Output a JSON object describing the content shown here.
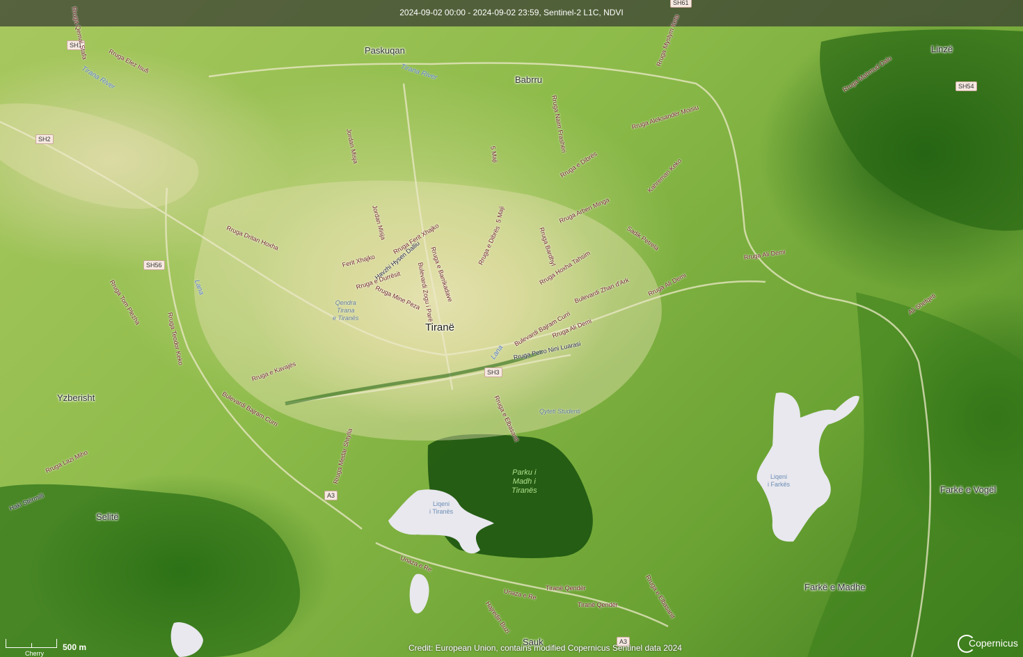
{
  "header": {
    "title": "2024-09-02 00:00 - 2024-09-02 23:59, Sentinel-2 L1C, NDVI"
  },
  "places": {
    "paskuqan": "Paskuqan",
    "babrru": "Babrru",
    "linze": "Linzë",
    "tirane": "Tiranë",
    "yzberisht": "Yzberisht",
    "selite": "Selitë",
    "farke_vogel": "Farkë e Vogël",
    "farke_madhe": "Farkë e Madhe",
    "sauk": "Sauk"
  },
  "shields": {
    "sh1": "SH1",
    "sh2": "SH2",
    "sh56": "SH56",
    "sh3": "SH3",
    "sh54": "SH54",
    "sh61": "SH61",
    "a3_west": "A3",
    "a3_east": "A3"
  },
  "water": {
    "tirana_river_west": "Tirana River",
    "tirana_river_north": "Tirana River",
    "lana_west": "Lana",
    "lana_center": "Lana"
  },
  "lakes": {
    "tirana": "Liqeni\ni Tiranës",
    "farkes": "Liqeni\ni Farkës"
  },
  "parks": {
    "grand_park": "Parku i\nMadh i\nTiranës"
  },
  "pois": {
    "center": "Qendra\nTirana\ne Tiranës",
    "student_city": "Qyteti Studenti"
  },
  "streets": {
    "elez_isufi": "Rruga Elez Isufi",
    "qemal_stafa": "Rruga Qemal Stafa",
    "myslym": "Rruga Myslym Keta",
    "mahmud_dalu": "Rruga Mahmud Dalu",
    "jordan_misja_1": "Jordan Misja",
    "jordan_misja_2": "Jordan Misja",
    "naim_frasheri": "Rruga Naim Frashëri",
    "aleksander_moisiu": "Rruga Aleksandër Moisiu",
    "dibres_1": "Rruga e Dibrës",
    "dibres_2": "Rruga e Dibrës",
    "kahreman_keko": "Kahreman Keko",
    "maji_1": "5 Maji",
    "maji_2": "5 Maji",
    "arben_minga": "Rruga Arben Minga",
    "sadik_petrela": "Sadik Petrela",
    "dritan_hoxha": "Rruga Dritan Hoxha",
    "fenit_xhajko": "Rruga Ferit Xhajko",
    "ferit_xhajko_2": "Ferit Xhajko",
    "hysen_dalliu": "Havzhi Hysen Dalliu",
    "barrikadave": "Rruga e Barrikadave",
    "zogu": "Bulevardi Zogu i Parë",
    "bardhyl": "Rruga Bardhyl",
    "hoxha_tahsim": "Rruga Hoxha Tahsim",
    "zhan_dark": "Bulevardi Zhan d'Ark",
    "ali_demi_1": "Rruga Ali Demi",
    "ali_demi_2": "Rruga Ali Demi",
    "ali_demi_3": "Rruga Ali Demi",
    "ali_shefqeti": "Ali Shefqeti",
    "durresit": "Rruga e Durrësit",
    "mine_peza": "Rruga Mine Peza",
    "bajram_curri_east": "Bulevardi Bajram Curri",
    "petro_nini": "Rruga Petro Nini Luarasi",
    "kavajes": "Rruga e Kavajës",
    "bajram_curri_west": "Bulevardi Bajram Curri",
    "elbasanit_1": "Rruga e Elbasanit",
    "elbasanit_2": "Rruga e Elbasanit",
    "teodor_keko": "Rruga Teodor Keko",
    "tom_plezha": "Rruga Tom Plezha",
    "medar_shtylla": "Rruga Medar Shtylla",
    "lazi_miho": "Rruga Lazi Miho",
    "haki_stermilli": "Haki Stërmilli",
    "unaza_1": "Unaza e Re",
    "unaza_2": "Unaza e Re",
    "tirane_qender_1": "Tiranë Qendër",
    "tirane_qender_2": "Tiranë Qendër",
    "hamit_buzi": "Hajredin Buzi"
  },
  "scale": {
    "label": "500 m",
    "sub": "Cherry"
  },
  "credit": "Credit: European Union, contains modified Copernicus Sentinel data 2024",
  "logo": {
    "text": "Copernicus"
  },
  "colors": {
    "vegetation_dense": "#1f5e12",
    "vegetation_medium": "#6aa233",
    "urban": "#e6e3b2",
    "lake": "#e8e8ee",
    "street_label": "#6b1f1f"
  }
}
